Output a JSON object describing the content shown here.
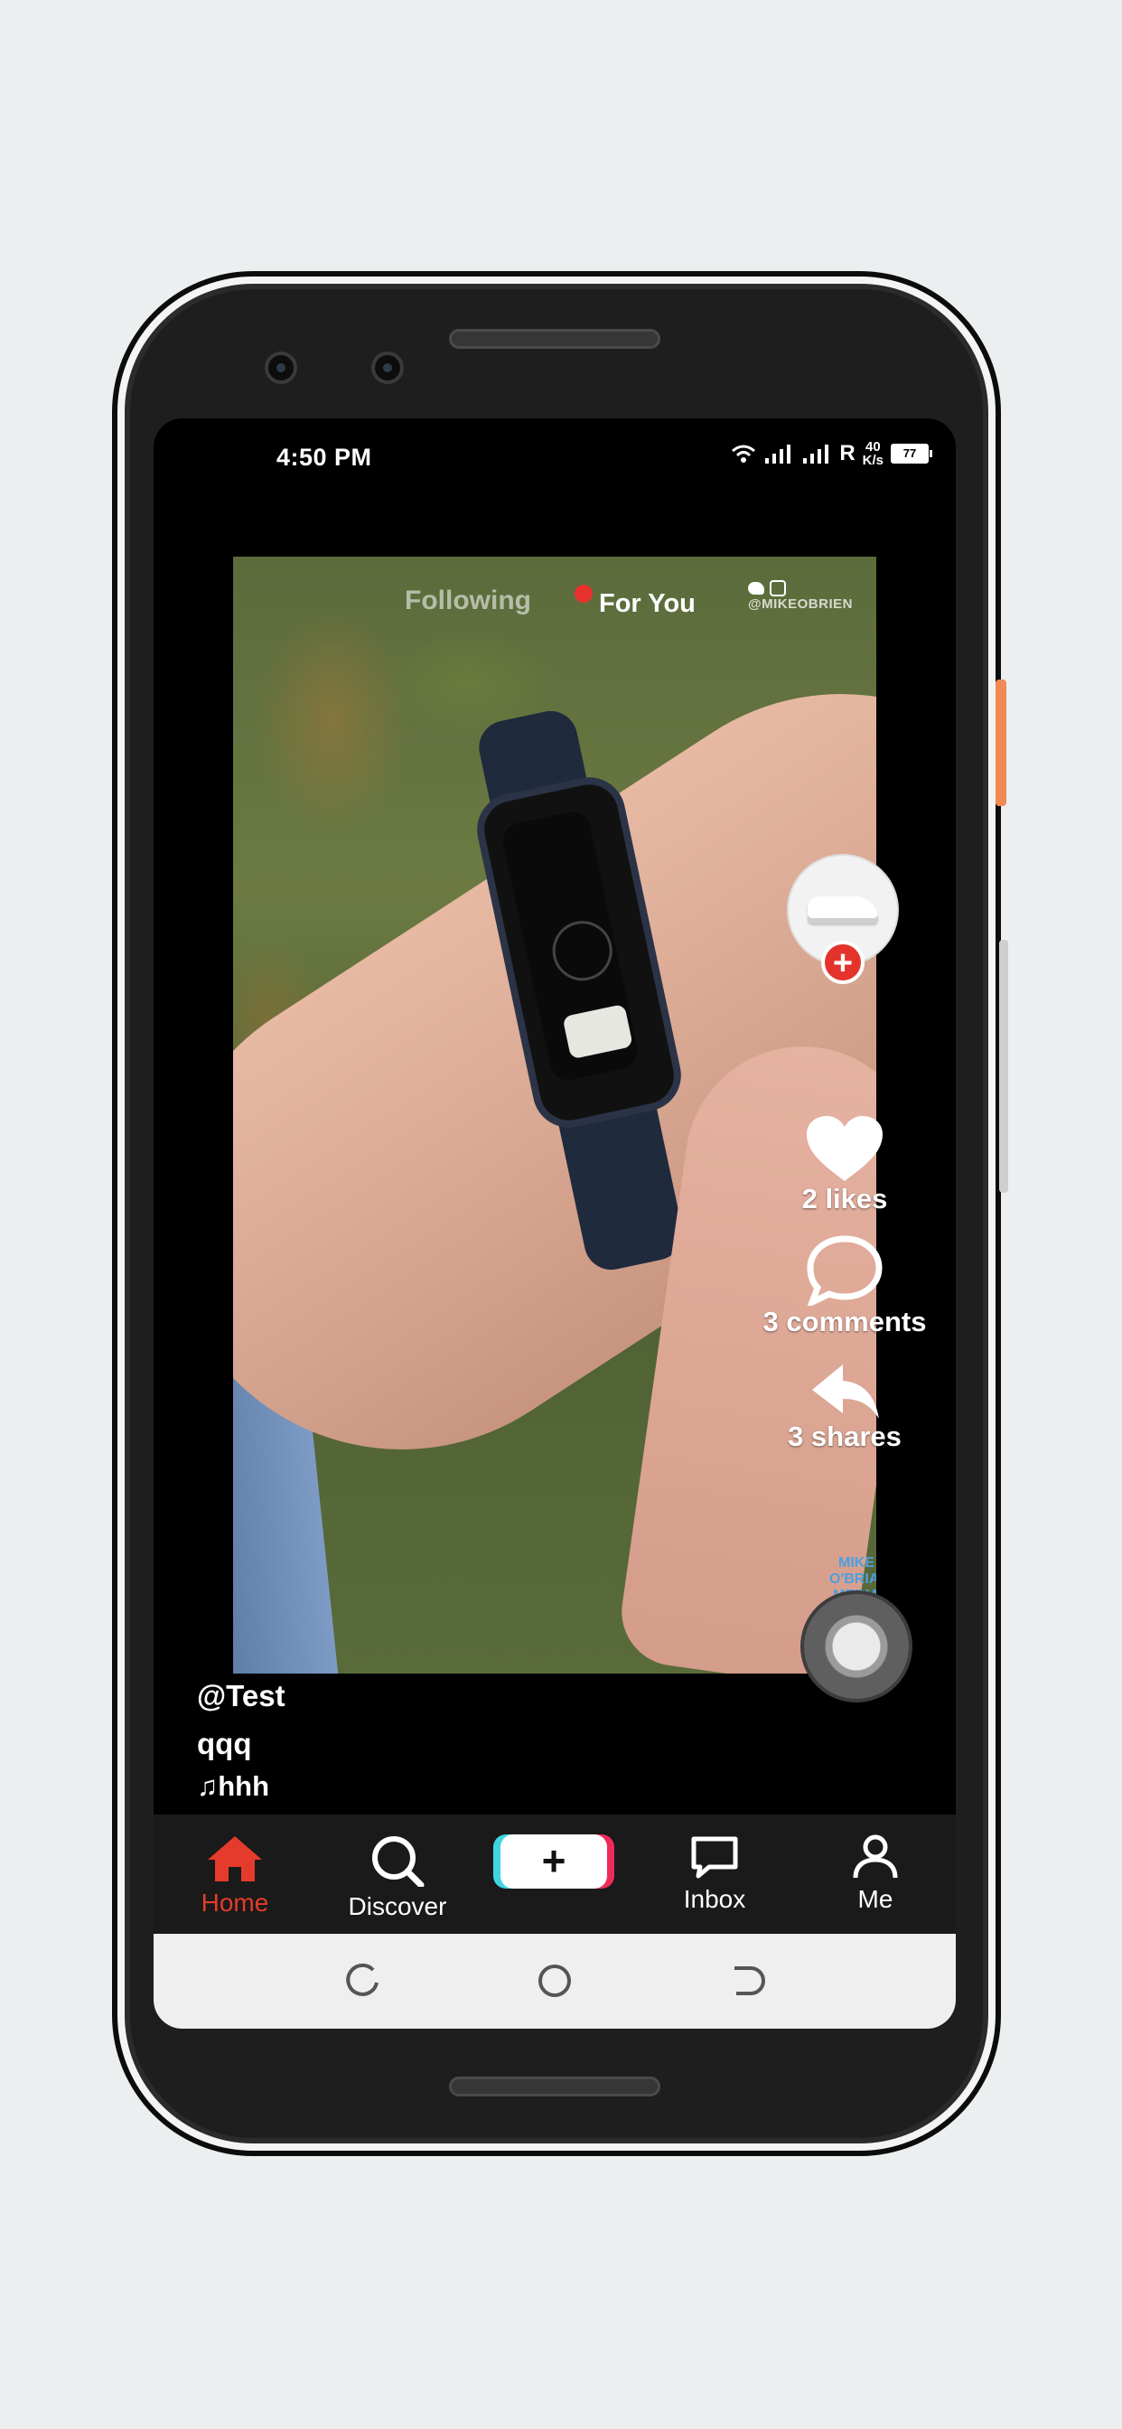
{
  "status_bar": {
    "time": "4:50 PM",
    "roaming": "R",
    "net_speed_value": "40",
    "net_speed_unit": "K/s",
    "battery": "77"
  },
  "feed_tabs": {
    "following": "Following",
    "for_you": "For You"
  },
  "video": {
    "watermark_handle": "@MIKEOBRIEN",
    "watermark_brand": "MIKE O'BRIAN MEDIA"
  },
  "actions": {
    "likes": "2 likes",
    "comments": "3 comments",
    "shares": "3 shares"
  },
  "post": {
    "username": "@Test",
    "description": "qqq",
    "music": "♫hhh"
  },
  "bottom_nav": {
    "home": "Home",
    "discover": "Discover",
    "create": "+",
    "inbox": "Inbox",
    "me": "Me"
  },
  "colors": {
    "accent": "#e53b2c",
    "follow_badge": "#e3332b",
    "create_left": "#3fd6e0",
    "create_right": "#ee2c5a"
  }
}
